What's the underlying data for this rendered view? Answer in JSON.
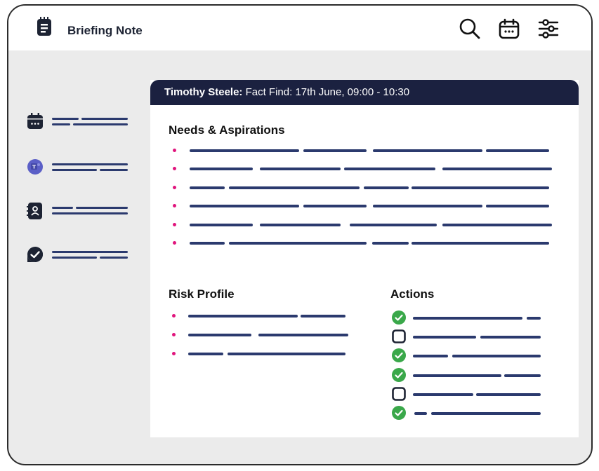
{
  "app": {
    "title": "Briefing Note"
  },
  "header_icons": [
    "search-icon",
    "calendar-icon",
    "settings-sliders-icon"
  ],
  "sidebar": {
    "items": [
      {
        "icon": "calendar-icon"
      },
      {
        "icon": "teams-icon"
      },
      {
        "icon": "contact-book-icon"
      },
      {
        "icon": "check-circle-icon"
      }
    ]
  },
  "briefing": {
    "client_name": "Timothy Steele:",
    "meeting_info": " Fact Find: 17th June, 09:00 - 10:30"
  },
  "sections": {
    "needs_title": "Needs & Aspirations",
    "risk_title": "Risk Profile",
    "actions_title": "Actions"
  },
  "actions": [
    {
      "done": true
    },
    {
      "done": false
    },
    {
      "done": true
    },
    {
      "done": true
    },
    {
      "done": false
    },
    {
      "done": true
    }
  ],
  "colors": {
    "header_bar": "#1b2140",
    "bullet": "#e0157d",
    "placeholder_line": "#2b3a6e",
    "check_green": "#3aa84a",
    "teams_purple": "#5b5fc7"
  }
}
